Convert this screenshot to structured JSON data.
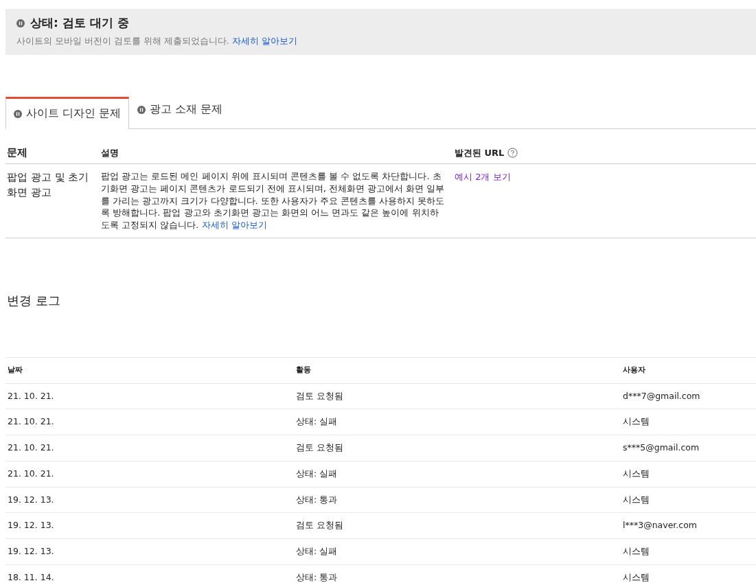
{
  "status_banner": {
    "title": "상태: 검토 대기 중",
    "message": "사이트의 모바일 버전이 검토를 위해 제출되었습니다.",
    "link": "자세히 알아보기"
  },
  "tabs": [
    {
      "label": "사이트 디자인 문제",
      "selected": true
    },
    {
      "label": "광고 소재 문제",
      "selected": false
    }
  ],
  "issues_table": {
    "columns": [
      "문제",
      "설명",
      "발견된 URL"
    ],
    "rows": [
      {
        "issue": "팝업 광고 및 초기화면 광고",
        "description": "팝업 광고는 로드된 메인 페이지 위에 표시되며 콘텐츠를 볼 수 없도록 차단합니다. 초기화면 광고는 페이지 콘텐츠가 로드되기 전에 표시되며, 전체화면 광고에서 화면 일부를 가리는 광고까지 크기가 다양합니다. 또한 사용자가 주요 콘텐츠를 사용하지 못하도록 방해합니다. 팝업 광고와 초기화면 광고는 화면의 어느 면과도 같은 높이에 위치하도록 고정되지 않습니다.",
        "description_link": "자세히 알아보기",
        "urls_link": "예시 2개 보기"
      }
    ]
  },
  "change_log": {
    "title": "변경 로그",
    "columns": [
      "날짜",
      "활동",
      "사용자"
    ],
    "rows": [
      [
        "21. 10. 21.",
        "검토 요청됨",
        "d***7@gmail.com"
      ],
      [
        "21. 10. 21.",
        "상태: 실패",
        "시스템"
      ],
      [
        "21. 10. 21.",
        "검토 요청됨",
        "s***5@gmail.com"
      ],
      [
        "21. 10. 21.",
        "상태: 실패",
        "시스템"
      ],
      [
        "19. 12. 13.",
        "상태: 통과",
        "시스템"
      ],
      [
        "19. 12. 13.",
        "검토 요청됨",
        "l***3@naver.com"
      ],
      [
        "19. 12. 13.",
        "상태: 실패",
        "시스템"
      ],
      [
        "18. 11. 14.",
        "상태: 통과",
        "시스템"
      ]
    ]
  }
}
